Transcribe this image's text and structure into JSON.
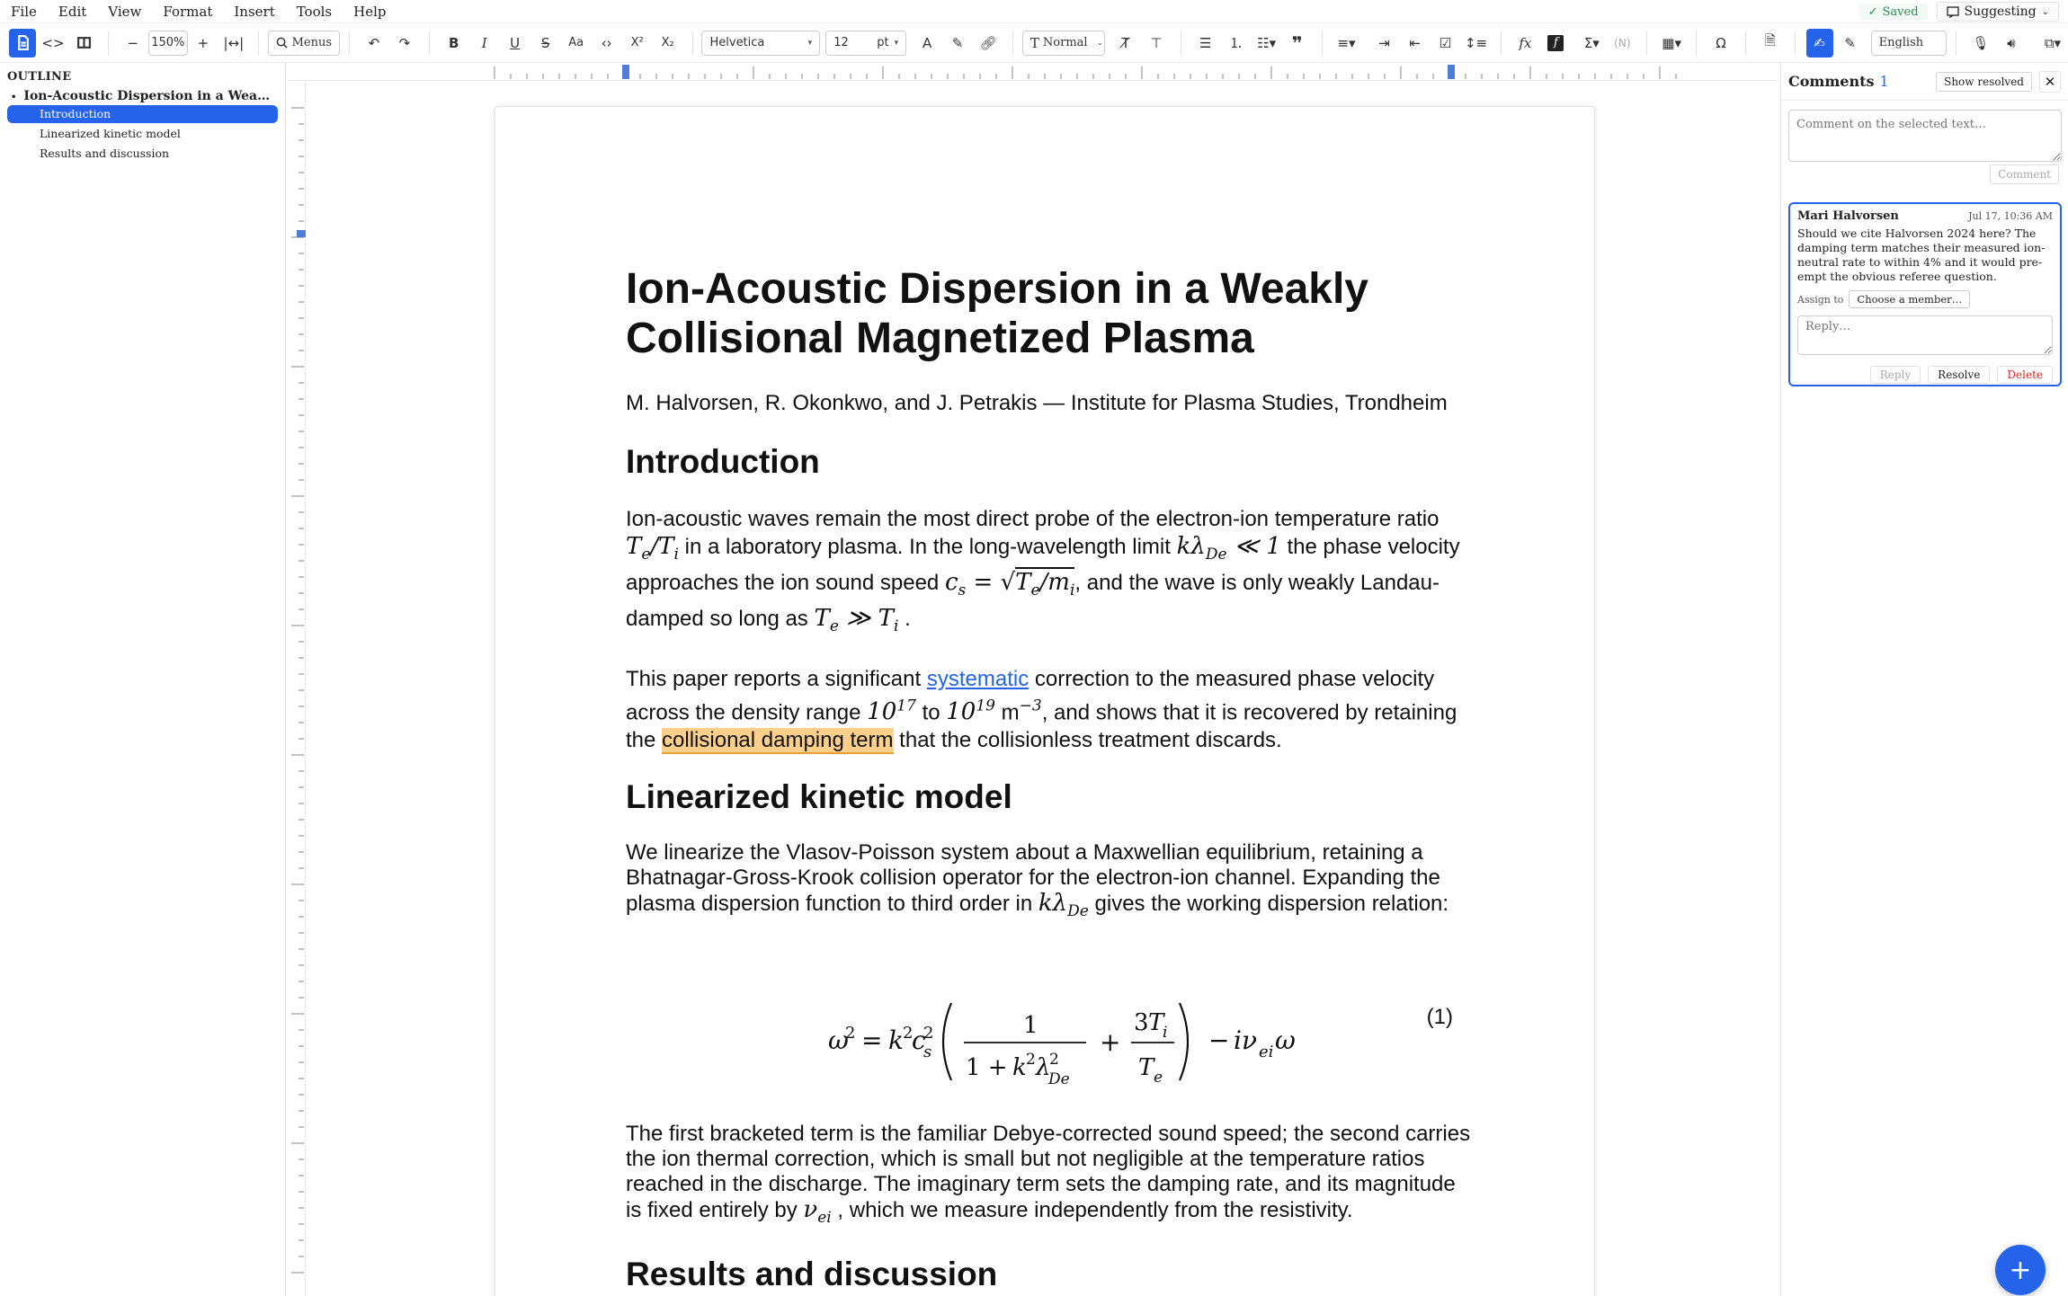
{
  "menu": [
    "File",
    "Edit",
    "View",
    "Format",
    "Insert",
    "Tools",
    "Help"
  ],
  "status": {
    "saved": "Saved",
    "mode": "Suggesting"
  },
  "toolbar": {
    "zoom": "150%",
    "menus": "Menus",
    "font": "Helvetica",
    "size": "12",
    "unit": "pt",
    "style": "Normal",
    "language": "English"
  },
  "outline": {
    "heading": "OUTLINE",
    "doc": "Ion-Acoustic Dispersion in a Weakly Collisional Magnetized Plasma",
    "items": [
      "Introduction",
      "Linearized kinetic model",
      "Results and discussion"
    ]
  },
  "doc": {
    "title": "Ion-Acoustic Dispersion in a Weakly Collisional Magnetized Plasma",
    "authors": "M. Halvorsen, R. Okonkwo, and J. Petrakis — Institute for Plasma Studies, Trondheim",
    "h_intro": "Introduction",
    "p1a": "Ion-acoustic waves remain the most direct probe of the electron-ion temperature ratio",
    "p1b": "in a laboratory plasma. In the long-wavelength limit",
    "p1c": "the phase velocity approaches the ion sound speed",
    "p1d": ", and the wave is only weakly Landau-damped so long as",
    "p2a": "This paper reports a significant",
    "p2link": "systematic",
    "p2b": "correction to the measured phase velocity across the density range",
    "p2c": "to",
    "p2d": "m",
    "p2e": ", and shows that it is recovered by retaining the",
    "p2hl": "collisional damping term",
    "p2f": "that the collisionless treatment discards.",
    "h_model": "Linearized kinetic model",
    "p3a": "We linearize the Vlasov-Poisson system about a Maxwellian equilibrium, retaining a Bhatnagar-Gross-Krook collision operator for the electron-ion channel. Expanding the plasma dispersion function to third order in",
    "p3b": "gives the working dispersion relation:",
    "eqnum": "(1)",
    "p4a": "The first bracketed term is the familiar Debye-corrected sound speed; the second carries the ion thermal correction, which is small but not negligible at the temperature ratios reached in the discharge. The imaginary term sets the damping rate, and its magnitude is fixed entirely by",
    "p4b": ", which we measure independently from the resistivity.",
    "h_results": "Results and discussion"
  },
  "comments": {
    "title": "Comments",
    "count": "1",
    "show_resolved": "Show resolved",
    "placeholder": "Comment on the selected text…",
    "comment_btn": "Comment",
    "thread": {
      "author": "Mari Halvorsen",
      "time": "Jul 17, 10:36 AM",
      "body": "Should we cite Halvorsen 2024 here? The damping term matches their measured ion-neutral rate to within 4% and it would pre-empt the obvious referee question.",
      "assign_label": "Assign to",
      "assign_value": "Choose a member…",
      "reply_placeholder": "Reply…",
      "reply": "Reply",
      "resolve": "Resolve",
      "delete": "Delete"
    }
  },
  "colors": {
    "accent": "#2563eb",
    "highlight": "#fcd08a",
    "saved": "#2e8b57",
    "delete": "#dc2626"
  }
}
